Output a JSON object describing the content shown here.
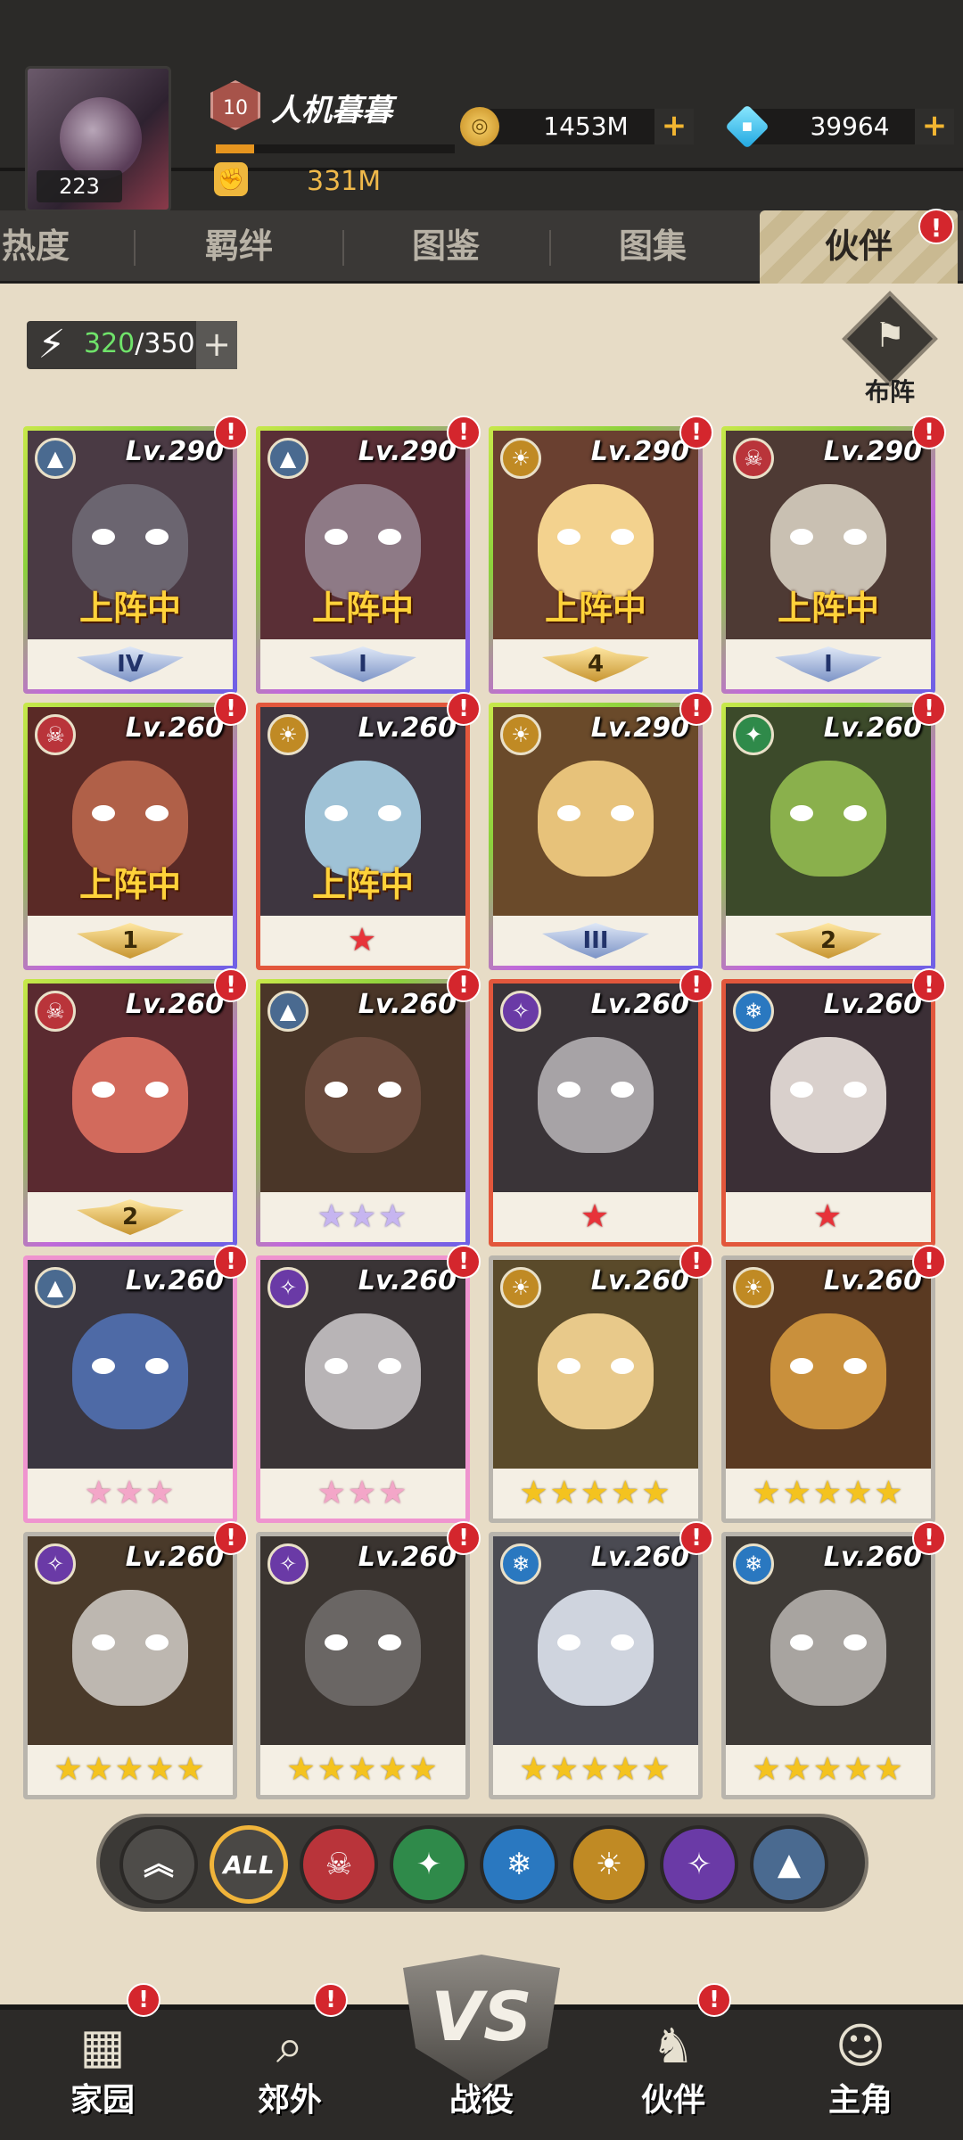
{
  "player": {
    "level_badge": "223",
    "rank": "10",
    "name": "人机暮暮",
    "xp_progress": 0.16,
    "power": "331M"
  },
  "currencies": [
    {
      "icon": "gold-coin-icon",
      "value": "1453M",
      "plus": "+"
    },
    {
      "icon": "diamond-icon",
      "value": "39964",
      "plus": "+"
    }
  ],
  "tabs": [
    {
      "label": "热度",
      "active": false
    },
    {
      "label": "羁绊",
      "active": false
    },
    {
      "label": "图鉴",
      "active": false
    },
    {
      "label": "图集",
      "active": false
    },
    {
      "label": "伙伴",
      "active": true
    }
  ],
  "tab_badge": "!",
  "stamina": {
    "current": "320",
    "max": "/350",
    "plus": "+"
  },
  "formation_label": "布阵",
  "deploy_text": "上阵中",
  "heroes": [
    {
      "lv": "Lv.290",
      "fac": "G",
      "deployed": true,
      "grade": "IV",
      "stars": 0,
      "star": "",
      "rarity": "rainbow",
      "bg": "#4a3a44",
      "skin": "#6b6570"
    },
    {
      "lv": "Lv.290",
      "fac": "G",
      "deployed": true,
      "grade": "I",
      "stars": 0,
      "star": "",
      "rarity": "rainbow",
      "bg": "#5a2f36",
      "skin": "#8e7a86"
    },
    {
      "lv": "Lv.290",
      "fac": "S",
      "deployed": true,
      "grade": "4",
      "stars": 0,
      "star": "",
      "rarity": "rainbow",
      "bg": "#6a4030",
      "skin": "#f3d28e"
    },
    {
      "lv": "Lv.290",
      "fac": "K",
      "deployed": true,
      "grade": "I",
      "stars": 0,
      "star": "",
      "rarity": "rainbow",
      "bg": "#4e3a34",
      "skin": "#c9c0b2"
    },
    {
      "lv": "Lv.260",
      "fac": "K",
      "deployed": true,
      "grade": "1",
      "stars": 0,
      "star": "",
      "rarity": "rainbow",
      "bg": "#5a2a26",
      "skin": "#b06048"
    },
    {
      "lv": "Lv.260",
      "fac": "S",
      "deployed": true,
      "grade": "",
      "stars": 1,
      "star": "red",
      "rarity": "red",
      "bg": "#3e3640",
      "skin": "#9fc2d6"
    },
    {
      "lv": "Lv.290",
      "fac": "S",
      "deployed": false,
      "grade": "III",
      "stars": 0,
      "star": "",
      "rarity": "rainbow",
      "bg": "#6a4a2a",
      "skin": "#e7c27a"
    },
    {
      "lv": "Lv.260",
      "fac": "D",
      "deployed": false,
      "grade": "2",
      "stars": 0,
      "star": "",
      "rarity": "rainbow",
      "bg": "#3c4a2a",
      "skin": "#8ab04c"
    },
    {
      "lv": "Lv.260",
      "fac": "K",
      "deployed": false,
      "grade": "2",
      "stars": 0,
      "star": "",
      "rarity": "rainbow",
      "bg": "#5a2a30",
      "skin": "#d26a5c"
    },
    {
      "lv": "Lv.260",
      "fac": "G",
      "deployed": false,
      "grade": "",
      "stars": 3,
      "star": "lav",
      "rarity": "rainbow",
      "bg": "#4a3628",
      "skin": "#6a4a3c"
    },
    {
      "lv": "Lv.260",
      "fac": "L",
      "deployed": false,
      "grade": "",
      "stars": 1,
      "star": "red",
      "rarity": "red",
      "bg": "#3a3438",
      "skin": "#a7a3a6"
    },
    {
      "lv": "Lv.260",
      "fac": "I",
      "deployed": false,
      "grade": "",
      "stars": 1,
      "star": "red",
      "rarity": "red",
      "bg": "#3b2f36",
      "skin": "#d9d0cc"
    },
    {
      "lv": "Lv.260",
      "fac": "G",
      "deployed": false,
      "grade": "",
      "stars": 3,
      "star": "pink",
      "rarity": "pink",
      "bg": "#3a3640",
      "skin": "#4e6aa6"
    },
    {
      "lv": "Lv.260",
      "fac": "L",
      "deployed": false,
      "grade": "",
      "stars": 3,
      "star": "pink",
      "rarity": "pink",
      "bg": "#3a3436",
      "skin": "#b8b4b6"
    },
    {
      "lv": "Lv.260",
      "fac": "S",
      "deployed": false,
      "grade": "",
      "stars": 5,
      "star": "gold",
      "rarity": "gray",
      "bg": "#5a4a2a",
      "skin": "#e8c98a"
    },
    {
      "lv": "Lv.260",
      "fac": "S",
      "deployed": false,
      "grade": "",
      "stars": 5,
      "star": "gold",
      "rarity": "gray",
      "bg": "#5a3a22",
      "skin": "#c9903c"
    },
    {
      "lv": "Lv.260",
      "fac": "L",
      "deployed": false,
      "grade": "",
      "stars": 5,
      "star": "gold",
      "rarity": "gray",
      "bg": "#4a3a2a",
      "skin": "#bdb7b0"
    },
    {
      "lv": "Lv.260",
      "fac": "L",
      "deployed": false,
      "grade": "",
      "stars": 5,
      "star": "gold",
      "rarity": "gray",
      "bg": "#3a3430",
      "skin": "#6a6664"
    },
    {
      "lv": "Lv.260",
      "fac": "I",
      "deployed": false,
      "grade": "",
      "stars": 5,
      "star": "gold",
      "rarity": "gray",
      "bg": "#4a4a52",
      "skin": "#cfd4de"
    },
    {
      "lv": "Lv.260",
      "fac": "I",
      "deployed": false,
      "grade": "",
      "stars": 5,
      "star": "gold",
      "rarity": "gray",
      "bg": "#3e3a36",
      "skin": "#a8a4a0"
    }
  ],
  "filters": [
    {
      "name": "sort-up-icon",
      "label": "︽",
      "color": "#4e4c49"
    },
    {
      "name": "all-filter-icon",
      "label": "ALL",
      "color": "#4a4845"
    },
    {
      "name": "skull-faction-icon",
      "label": "☠",
      "color": "#b9343a"
    },
    {
      "name": "nature-faction-icon",
      "label": "✦",
      "color": "#2f8a4a"
    },
    {
      "name": "ice-faction-icon",
      "label": "❄",
      "color": "#2a78c0"
    },
    {
      "name": "sun-faction-icon",
      "label": "☀",
      "color": "#c08a24"
    },
    {
      "name": "lightning-faction-icon",
      "label": "✧",
      "color": "#6a3aa6"
    },
    {
      "name": "tech-faction-icon",
      "label": "▲",
      "color": "#4a6a90"
    }
  ],
  "nav": [
    {
      "name": "nav-home",
      "label": "家园",
      "icon": "▦",
      "badge": "!"
    },
    {
      "name": "nav-outskirts",
      "label": "郊外",
      "icon": "⌕",
      "badge": "!"
    },
    {
      "name": "nav-battle",
      "label": "战役",
      "icon": "VS",
      "badge": ""
    },
    {
      "name": "nav-partners",
      "label": "伙伴",
      "icon": "♞",
      "badge": "!"
    },
    {
      "name": "nav-hero",
      "label": "主角",
      "icon": "☺",
      "badge": ""
    }
  ],
  "badge_text": "!"
}
